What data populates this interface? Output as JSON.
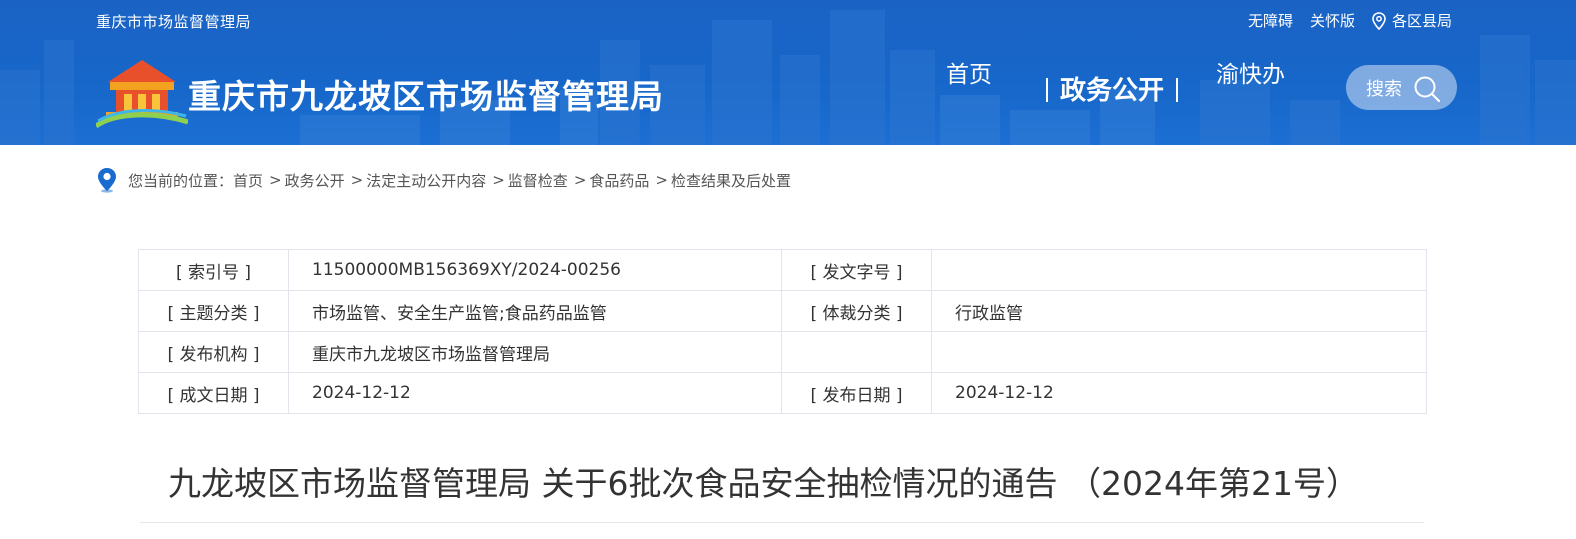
{
  "header": {
    "agency_top": "重庆市市场监督管理局",
    "links": {
      "accessibility": "无障碍",
      "care_mode": "关怀版",
      "districts": "各区县局"
    },
    "site_name": "重庆市九龙坡区市场监督管理局",
    "nav": {
      "home": "首页",
      "gov_open": "政务公开",
      "yu_kuai_ban": "渝快办"
    },
    "search_label": "搜索"
  },
  "breadcrumb": {
    "prefix": "您当前的位置：",
    "items": [
      "首页",
      "政务公开",
      "法定主动公开内容",
      "监督检查",
      "食品药品",
      "检查结果及后处置"
    ],
    "separator": ">"
  },
  "meta": {
    "rows": [
      {
        "l1": "[ 索引号 ]",
        "v1": "11500000MB156369XY/2024-00256",
        "l2": "[ 发文字号 ]",
        "v2": ""
      },
      {
        "l1": "[ 主题分类 ]",
        "v1": "市场监管、安全生产监管;食品药品监管",
        "l2": "[ 体裁分类 ]",
        "v2": "行政监管"
      },
      {
        "l1": "[ 发布机构 ]",
        "v1": "重庆市九龙坡区市场监督管理局",
        "l2": "",
        "v2": ""
      },
      {
        "l1": "[ 成文日期 ]",
        "v1": "2024-12-12",
        "l2": "[ 发布日期 ]",
        "v2": "2024-12-12"
      }
    ]
  },
  "article": {
    "title": "九龙坡区市场监督管理局 关于6批次食品安全抽检情况的通告 （2024年第21号）"
  },
  "colors": {
    "header_blue": "#1766c9",
    "border": "#e1e4ea",
    "text": "#333333"
  },
  "icons": [
    "logo-emblem-icon",
    "location-pin-icon",
    "search-icon",
    "breadcrumb-location-icon"
  ]
}
